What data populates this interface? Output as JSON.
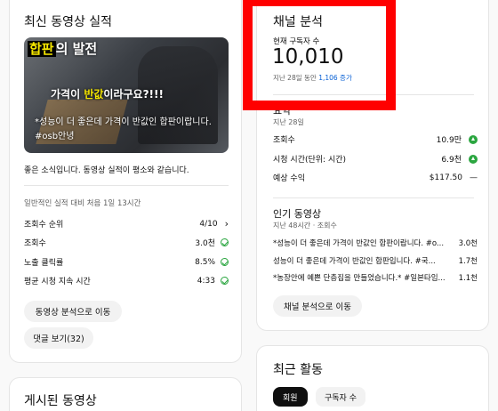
{
  "left": {
    "title": "최신 동영상 실적",
    "thumb": {
      "overlay1a": "합판",
      "overlay1b": "의 발전",
      "overlay2a": "가격이 ",
      "overlay2b": "반값",
      "overlay2c": "이라구요?!!!"
    },
    "video_title": "*성능이 더 좋은데 가격이 반값인 합판이랍니다. #osb안녕",
    "message": "좋은 소식입니다. 동영상 실적이 평소와 같습니다.",
    "sub": "일반적인 실적 대비 처음 1일 13시간",
    "metrics": [
      {
        "label": "조회수 순위",
        "value": "4/10"
      },
      {
        "label": "조회수",
        "value": "3.0천"
      },
      {
        "label": "노출 클릭률",
        "value": "8.5%"
      },
      {
        "label": "평균 시청 지속 시간",
        "value": "4:33"
      }
    ],
    "btn_analytics": "동영상 분석으로 이동",
    "btn_comments": "댓글 보기(32)",
    "published_title": "게시된 동영상"
  },
  "right": {
    "title": "채널 분석",
    "subs_label": "현재 구독자 수",
    "subs_value": "10,010",
    "subs_change_prefix": "지난 28일 동안 ",
    "subs_change_value": "1,106 증가",
    "summary_title": "요약",
    "summary_period": "지난 28일",
    "summary": [
      {
        "label": "조회수",
        "value": "10.9만"
      },
      {
        "label": "시청 시간(단위: 시간)",
        "value": "6.9천"
      },
      {
        "label": "예상 수익",
        "value": "$117.50"
      }
    ],
    "summary_dash": "—",
    "popular_title": "인기 동영상",
    "popular_sub": "지난 48시간 · 조회수",
    "popular": [
      {
        "title": "*성능이 더 좋은데 가격이 반값인 합판이랍니다. #o...",
        "value": "3.0천"
      },
      {
        "title": "성능이 더 좋은데 가격이 반값인 합판입니다. #국...",
        "value": "1.7천"
      },
      {
        "title": "*농장안에 예쁜 단층집을 만들었습니다.* #일본타임...",
        "value": "1.1천"
      }
    ],
    "btn_channel": "채널 분석으로 이동",
    "recent_title": "최근 활동",
    "tabs": [
      "회원",
      "구독자 수"
    ]
  },
  "colors": {
    "accent_red": "#ff0000",
    "positive": "#2ba640",
    "link_blue": "#065fd4"
  }
}
